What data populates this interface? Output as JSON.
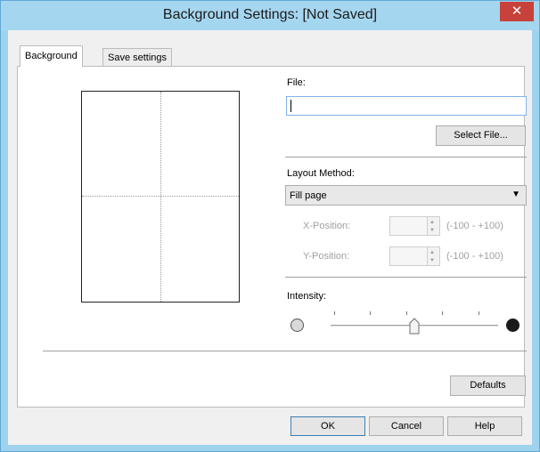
{
  "window": {
    "title": "Background Settings: [Not Saved]",
    "close_glyph": "✕"
  },
  "tabs": [
    {
      "label": "Background",
      "active": true
    },
    {
      "label": "Save settings",
      "active": false
    }
  ],
  "file": {
    "label": "File:",
    "value": "",
    "select_button": "Select File..."
  },
  "layout": {
    "label": "Layout Method:",
    "selected": "Fill page",
    "x_label": "X-Position:",
    "x_range": "(-100 - +100)",
    "x_value": "",
    "y_label": "Y-Position:",
    "y_range": "(-100 - +100)",
    "y_value": ""
  },
  "intensity": {
    "label": "Intensity:",
    "level": 0.5,
    "low_icon": "light-circle-icon",
    "high_icon": "dark-circle-icon"
  },
  "buttons": {
    "defaults": "Defaults",
    "ok": "OK",
    "cancel": "Cancel",
    "help": "Help"
  },
  "colors": {
    "titlebar": "#a5d6f0",
    "close": "#c7423a",
    "focus_border": "#7eb4ea"
  }
}
